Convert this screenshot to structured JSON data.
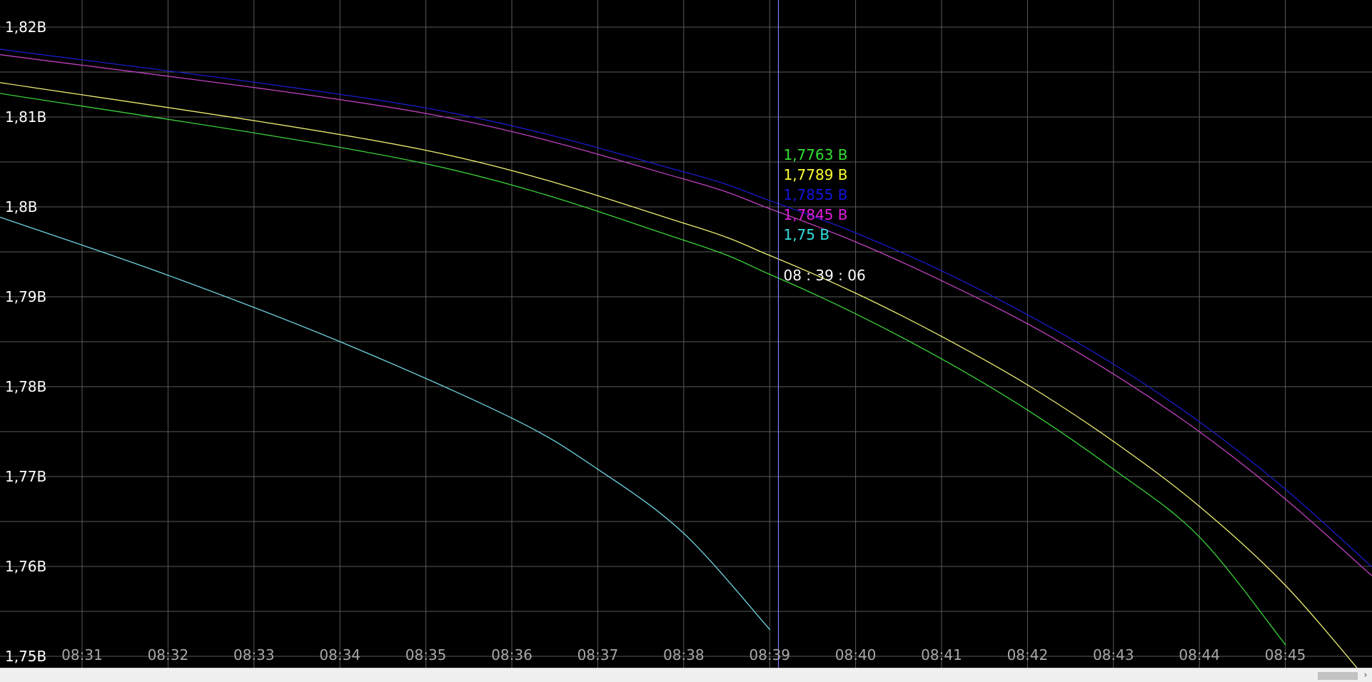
{
  "chart_data": {
    "type": "line",
    "title": "",
    "xlabel": "",
    "ylabel": "",
    "x_ticks": [
      "08:31",
      "08:32",
      "08:33",
      "08:34",
      "08:35",
      "08:36",
      "08:37",
      "08:38",
      "08:39",
      "08:40",
      "08:41",
      "08:42",
      "08:43",
      "08:44",
      "08:45"
    ],
    "y_ticks": [
      "1,82B",
      "1,81B",
      "1,8B",
      "1,79B",
      "1,78B",
      "1,77B",
      "1,76B",
      "1,75B"
    ],
    "xlim": [
      8.5,
      8.7667
    ],
    "ylim": [
      1.75,
      1.822
    ],
    "x_unit": "hours",
    "grid": true,
    "legend": "none",
    "series": [
      {
        "color": "#3ad33a",
        "x": [
          8.5,
          8.5833,
          8.6333,
          8.65,
          8.6667,
          8.6833,
          8.7,
          8.7167,
          8.7333,
          8.75
        ],
        "values": [
          1.8127,
          1.8048,
          1.7963,
          1.7925,
          1.7881,
          1.7831,
          1.7774,
          1.7708,
          1.7633,
          1.7513
        ]
      },
      {
        "color": "#ecec70",
        "x": [
          8.5,
          8.5833,
          8.6333,
          8.65,
          8.6667,
          8.6833,
          8.7,
          8.7167,
          8.7333,
          8.75,
          8.7667
        ],
        "values": [
          1.8139,
          1.8063,
          1.7982,
          1.7946,
          1.7904,
          1.7856,
          1.7802,
          1.7739,
          1.7667,
          1.7579,
          1.7468
        ]
      },
      {
        "color": "#1a1acc",
        "x": [
          8.5,
          8.5833,
          8.6333,
          8.65,
          8.6667,
          8.6833,
          8.7,
          8.7167,
          8.7333,
          8.75,
          8.7667
        ],
        "values": [
          1.8176,
          1.811,
          1.8039,
          1.8007,
          1.7971,
          1.7929,
          1.788,
          1.7825,
          1.7761,
          1.7686,
          1.76
        ]
      },
      {
        "color": "#c040c0",
        "x": [
          8.5,
          8.5833,
          8.6333,
          8.65,
          8.6667,
          8.6833,
          8.7,
          8.7167,
          8.7333,
          8.75,
          8.7667
        ],
        "values": [
          1.817,
          1.8104,
          1.8031,
          1.7998,
          1.7961,
          1.7918,
          1.787,
          1.7814,
          1.775,
          1.7675,
          1.759
        ]
      },
      {
        "color": "#6fd3e0",
        "x": [
          8.5,
          8.5333,
          8.5667,
          8.6,
          8.6167,
          8.6333,
          8.65
        ],
        "values": [
          1.799,
          1.7924,
          1.785,
          1.7765,
          1.7708,
          1.7637,
          1.753
        ]
      }
    ],
    "readout": {
      "values": [
        {
          "text": "1,7763 B",
          "color": "#33e033"
        },
        {
          "text": "1,7789 B",
          "color": "#ffff33"
        },
        {
          "text": "1,7855 B",
          "color": "#1515dd"
        },
        {
          "text": "1,7845 B",
          "color": "#e01ee0"
        },
        {
          "text": "1,75 B",
          "color": "#33e0e0"
        }
      ],
      "time": "08 : 39 : 06",
      "cursor_x": 8.6517
    }
  },
  "colors": {
    "background": "#000000",
    "grid": "#5a5a5a",
    "cursor": "#8080ff"
  },
  "scrollbar": {
    "right_arrow": "›"
  }
}
